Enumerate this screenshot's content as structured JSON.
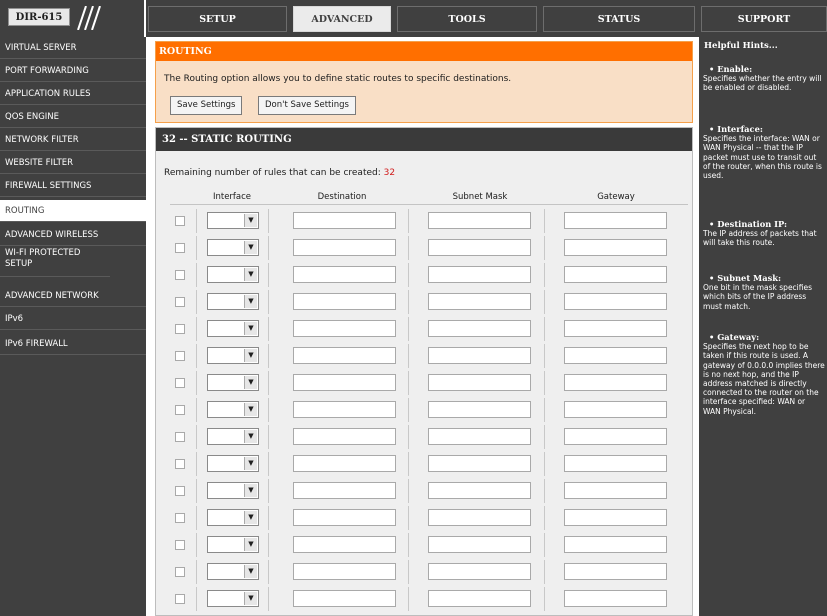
{
  "header": {
    "model": "DIR-615",
    "tabs": [
      {
        "label": "SETUP"
      },
      {
        "label": "ADVANCED"
      },
      {
        "label": "TOOLS"
      },
      {
        "label": "STATUS"
      },
      {
        "label": "SUPPORT"
      }
    ],
    "active_tab": "ADVANCED"
  },
  "sidebar": {
    "items": [
      {
        "label": "VIRTUAL SERVER"
      },
      {
        "label": "PORT FORWARDING"
      },
      {
        "label": "APPLICATION RULES"
      },
      {
        "label": "QOS ENGINE"
      },
      {
        "label": "NETWORK FILTER"
      },
      {
        "label": "WEBSITE FILTER"
      },
      {
        "label": "FIREWALL SETTINGS"
      },
      {
        "label": "ROUTING"
      },
      {
        "label": "ADVANCED WIRELESS"
      },
      {
        "label": "WI-FI PROTECTED SETUP"
      },
      {
        "label": "ADVANCED NETWORK"
      },
      {
        "label": "IPv6"
      },
      {
        "label": "IPv6 FIREWALL"
      }
    ],
    "active_item": "ROUTING"
  },
  "routing": {
    "title": "ROUTING",
    "description": "The Routing option allows you to define static routes to specific destinations.",
    "save_label": "Save Settings",
    "dont_save_label": "Don't Save Settings"
  },
  "static_routing": {
    "title": "32 -- STATIC ROUTING",
    "remaining_label": "Remaining number of rules that can be created:",
    "remaining_count": "32",
    "columns": [
      "Interface",
      "Destination",
      "Subnet Mask",
      "Gateway"
    ]
  },
  "hints": {
    "title": "Helpful Hints...",
    "items": [
      {
        "title": "• Enable:",
        "text": "Specifies whether the entry will be enabled or disabled."
      },
      {
        "title": "• Interface:",
        "text": "Specifies the interface: WAN or WAN Physical -- that the IP packet must use to transit out of the router, when this route is used."
      },
      {
        "title": "• Destination IP:",
        "text": "The IP address of packets that will take this route."
      },
      {
        "title": "• Subnet Mask:",
        "text": "One bit in the mask specifies which bits of the IP address must match."
      },
      {
        "title": "• Gateway:",
        "text": "Specifies the next hop to be taken if this route is used. A gateway of 0.0.0.0 implies there is no next hop, and the IP address matched is directly connected to the router on the interface specified: WAN or WAN Physical."
      }
    ]
  },
  "colors": {
    "frame": "#404040",
    "accent": "#ff6f00",
    "remaining_count": "#d11c1c"
  }
}
